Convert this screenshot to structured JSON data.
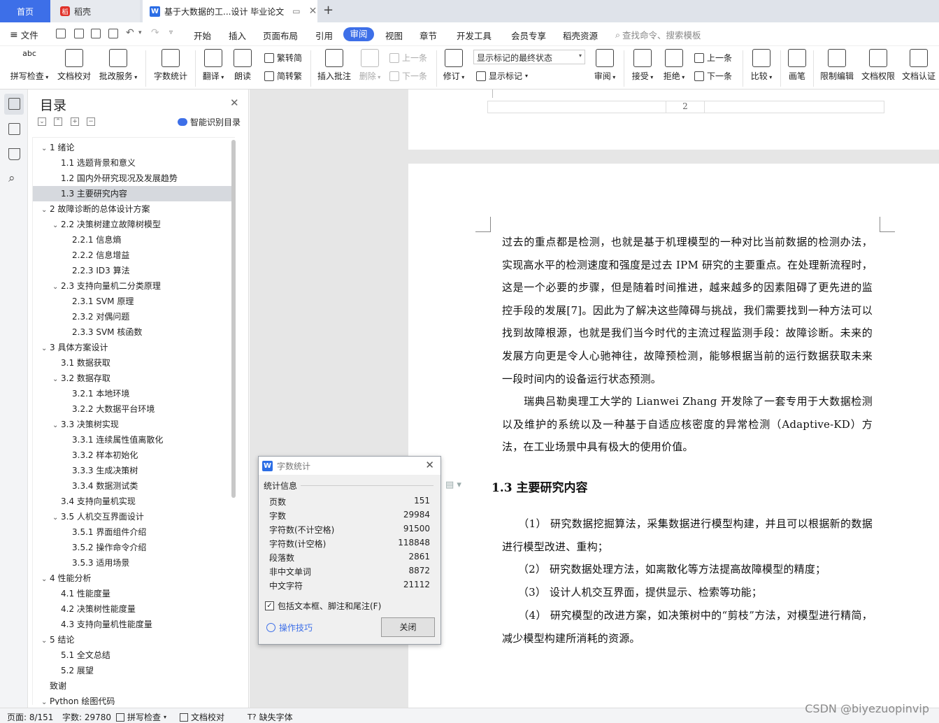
{
  "tabs": {
    "home": "首页",
    "daoke": "稻壳",
    "doc": "基于大数据的工...设计 毕业论文"
  },
  "menu": {
    "file": "文件",
    "items": [
      "开始",
      "插入",
      "页面布局",
      "引用",
      "审阅",
      "视图",
      "章节",
      "开发工具",
      "会员专享",
      "稻壳资源"
    ],
    "active": "审阅",
    "search_placeholder": "查找命令、搜索模板"
  },
  "ribbon": {
    "spell_top": "abc",
    "spell": "拼写检查",
    "proofread": "文档校对",
    "annotate_service": "批改服务",
    "word_count": "字数统计",
    "translate": "翻译",
    "read_aloud": "朗读",
    "trad_to_simp": "繁转简",
    "simp_to_trad": "简转繁",
    "insert_comment": "插入批注",
    "delete": "删除",
    "prev_comment": "上一条",
    "next_comment": "下一条",
    "revise": "修订",
    "mark_state": "显示标记的最终状态",
    "show_marks": "显示标记",
    "review": "审阅",
    "accept": "接受",
    "reject": "拒绝",
    "prev": "上一条",
    "next": "下一条",
    "compare": "比较",
    "pen": "画笔",
    "restrict_edit": "限制编辑",
    "doc_permission": "文档权限",
    "doc_certify": "文档认证"
  },
  "toc": {
    "title": "目录",
    "smart": "智能识别目录",
    "items": [
      {
        "text": "1  绪论",
        "level": 0,
        "caret": "expanded"
      },
      {
        "text": "1.1  选题背景和意义",
        "level": 1,
        "caret": "none"
      },
      {
        "text": "1.2  国内外研究现况及发展趋势",
        "level": 1,
        "caret": "none"
      },
      {
        "text": "1.3  主要研究内容",
        "level": 1,
        "caret": "none",
        "selected": true
      },
      {
        "text": "2  故障诊断的总体设计方案",
        "level": 0,
        "caret": "expanded"
      },
      {
        "text": "2.2  决策树建立故障树模型",
        "level": 1,
        "caret": "expanded"
      },
      {
        "text": "2.2.1  信息熵",
        "level": 2,
        "caret": "none"
      },
      {
        "text": "2.2.2  信息增益",
        "level": 2,
        "caret": "none"
      },
      {
        "text": "2.2.3 ID3 算法",
        "level": 2,
        "caret": "none"
      },
      {
        "text": "2.3  支持向量机二分类原理",
        "level": 1,
        "caret": "expanded"
      },
      {
        "text": "2.3.1 SVM 原理",
        "level": 2,
        "caret": "none"
      },
      {
        "text": "2.3.2  对偶问题",
        "level": 2,
        "caret": "none"
      },
      {
        "text": "2.3.3 SVM 核函数",
        "level": 2,
        "caret": "none"
      },
      {
        "text": "3  具体方案设计",
        "level": 0,
        "caret": "expanded"
      },
      {
        "text": "3.1  数据获取",
        "level": 1,
        "caret": "none"
      },
      {
        "text": "3.2  数据存取",
        "level": 1,
        "caret": "expanded"
      },
      {
        "text": "3.2.1  本地环境",
        "level": 2,
        "caret": "none"
      },
      {
        "text": "3.2.2  大数据平台环境",
        "level": 2,
        "caret": "none"
      },
      {
        "text": "3.3  决策树实现",
        "level": 1,
        "caret": "expanded"
      },
      {
        "text": "3.3.1  连续属性值离散化",
        "level": 2,
        "caret": "none"
      },
      {
        "text": "3.3.2  样本初始化",
        "level": 2,
        "caret": "none"
      },
      {
        "text": "3.3.3  生成决策树",
        "level": 2,
        "caret": "none"
      },
      {
        "text": "3.3.4  数据测试类",
        "level": 2,
        "caret": "none"
      },
      {
        "text": "3.4  支持向量机实现",
        "level": 1,
        "caret": "none"
      },
      {
        "text": "3.5  人机交互界面设计",
        "level": 1,
        "caret": "expanded"
      },
      {
        "text": "3.5.1  界面组件介绍",
        "level": 2,
        "caret": "none"
      },
      {
        "text": "3.5.2  操作命令介绍",
        "level": 2,
        "caret": "none"
      },
      {
        "text": "3.5.3  适用场景",
        "level": 2,
        "caret": "none"
      },
      {
        "text": "4  性能分析",
        "level": 0,
        "caret": "expanded"
      },
      {
        "text": "4.1  性能度量",
        "level": 1,
        "caret": "none"
      },
      {
        "text": "4.2  决策树性能度量",
        "level": 1,
        "caret": "none"
      },
      {
        "text": "4.3  支持向量机性能度量",
        "level": 1,
        "caret": "none"
      },
      {
        "text": "5  结论",
        "level": 0,
        "caret": "expanded"
      },
      {
        "text": "5.1  全文总结",
        "level": 1,
        "caret": "none"
      },
      {
        "text": "5.2  展望",
        "level": 1,
        "caret": "none"
      },
      {
        "text": "致谢",
        "level": 0,
        "caret": "none"
      },
      {
        "text": "Python 绘图代码",
        "level": 0,
        "caret": "expanded"
      }
    ]
  },
  "document": {
    "footer_page_number": "2",
    "paragraphs": [
      "过去的重点都是检测，也就是基于机理模型的一种对比当前数据的检测办法，实现高水平的检测速度和强度是过去 IPM 研究的主要重点。在处理新流程时，这是一个必要的步骤，但是随着时间推进，越来越多的因素阻碍了更先进的监控手段的发展[7]。因此为了解决这些障碍与挑战，我们需要找到一种方法可以找到故障根源，也就是我们当今时代的主流过程监测手段：故障诊断。未来的发展方向更是令人心驰神往，故障预检测，能够根据当前的运行数据获取未来一段时间内的设备运行状态预测。",
      "　　瑞典吕勒奥理工大学的 Lianwei Zhang 开发除了一套专用于大数据检测以及维护的系统以及一种基于自适应核密度的异常检测（Adaptive-KD）方法，在工业场景中具有极大的使用价值。"
    ],
    "heading": "1.3  主要研究内容",
    "items": [
      "　　（1）  研究数据挖掘算法，采集数据进行模型构建，并且可以根据新的数据进行模型改进、重构；",
      "　　（2）  研究数据处理方法，如离散化等方法提高故障模型的精度；",
      "　　（3）  设计人机交互界面，提供显示、检索等功能；",
      "　　（4）  研究模型的改进方案，如决策树中的“剪枝”方法，对模型进行精简，减少模型构建所消耗的资源。"
    ]
  },
  "dialog": {
    "title": "字数统计",
    "section": "统计信息",
    "stats": [
      {
        "label": "页数",
        "value": "151"
      },
      {
        "label": "字数",
        "value": "29984"
      },
      {
        "label": "字符数(不计空格)",
        "value": "91500"
      },
      {
        "label": "字符数(计空格)",
        "value": "118848"
      },
      {
        "label": "段落数",
        "value": "2861"
      },
      {
        "label": "非中文单词",
        "value": "8872"
      },
      {
        "label": "中文字符",
        "value": "21112"
      }
    ],
    "checkbox": "包括文本框、脚注和尾注(F)",
    "checkbox_checked": true,
    "tips": "操作技巧",
    "close": "关闭"
  },
  "status": {
    "page": "页面: 8/151",
    "words": "字数: 29780",
    "spell": "拼写检查",
    "proof": "文档校对",
    "missing_font": "缺失字体"
  },
  "watermark": "CSDN @biyezuopinvip",
  "colors": {
    "accent": "#3d6fe8",
    "daoke_red": "#e0322a"
  }
}
